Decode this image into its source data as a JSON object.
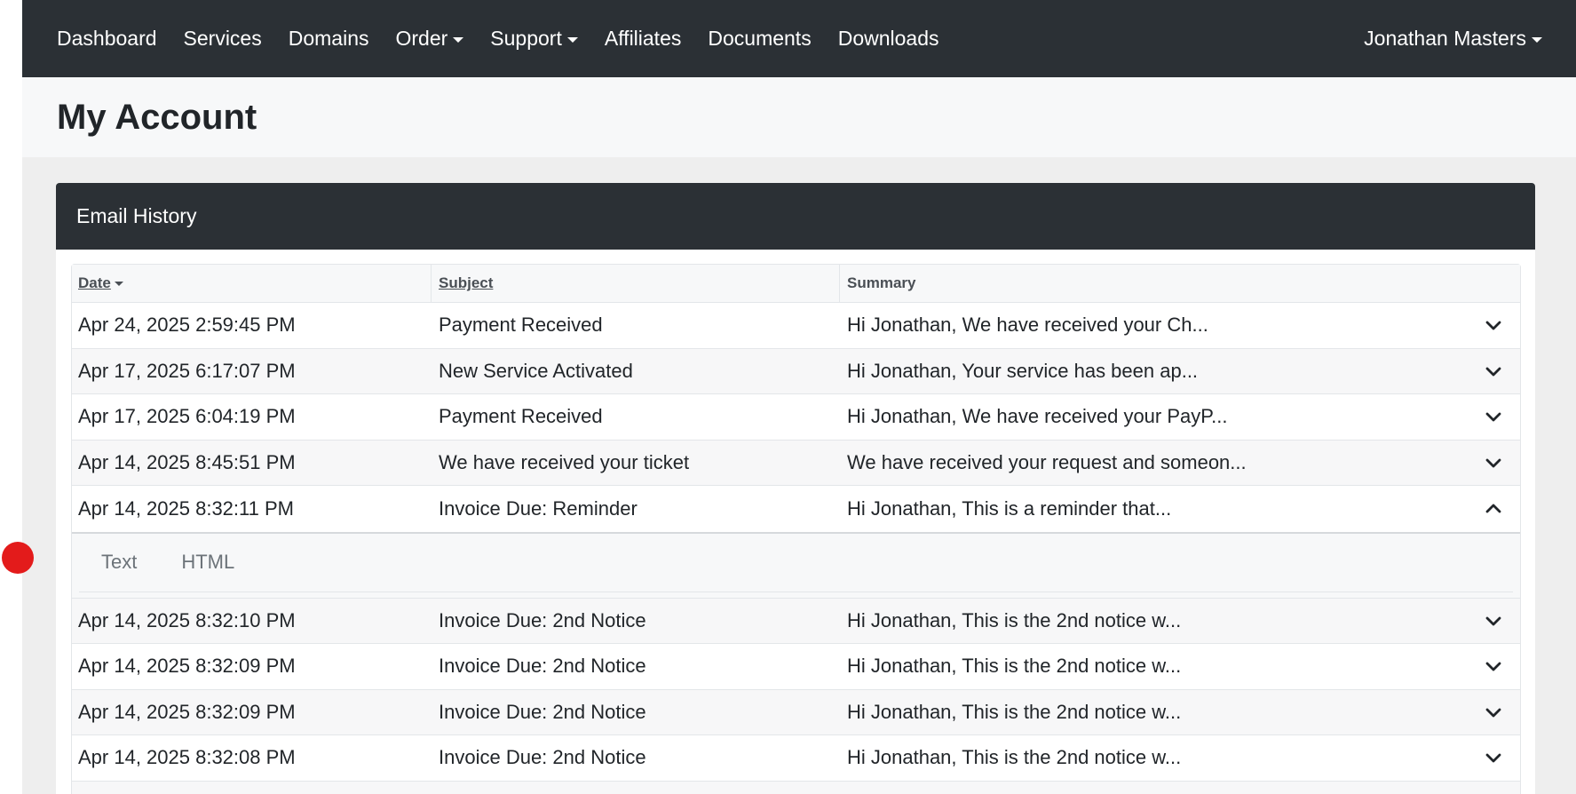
{
  "nav": {
    "items": [
      {
        "label": "Dashboard",
        "dropdown": false
      },
      {
        "label": "Services",
        "dropdown": false
      },
      {
        "label": "Domains",
        "dropdown": false
      },
      {
        "label": "Order",
        "dropdown": true
      },
      {
        "label": "Support",
        "dropdown": true
      },
      {
        "label": "Affiliates",
        "dropdown": false
      },
      {
        "label": "Documents",
        "dropdown": false
      },
      {
        "label": "Downloads",
        "dropdown": false
      }
    ],
    "user": "Jonathan Masters"
  },
  "page": {
    "title": "My Account"
  },
  "email_history": {
    "title": "Email History",
    "columns": {
      "date": "Date",
      "subject": "Subject",
      "summary": "Summary"
    },
    "rows": [
      {
        "date": "Apr 24, 2025 2:59:45 PM",
        "subject": "Payment Received",
        "summary": "Hi Jonathan, We have received your Ch...",
        "expanded": false
      },
      {
        "date": "Apr 17, 2025 6:17:07 PM",
        "subject": "New Service Activated",
        "summary": "Hi Jonathan, Your service has been ap...",
        "expanded": false
      },
      {
        "date": "Apr 17, 2025 6:04:19 PM",
        "subject": "Payment Received",
        "summary": "Hi Jonathan, We have received your PayP...",
        "expanded": false
      },
      {
        "date": "Apr 14, 2025 8:45:51 PM",
        "subject": "We have received your ticket",
        "summary": "We have received your request and someon...",
        "expanded": false
      },
      {
        "date": "Apr 14, 2025 8:32:11 PM",
        "subject": "Invoice Due: Reminder",
        "summary": "Hi Jonathan, This is a reminder that...",
        "expanded": true
      },
      {
        "date": "Apr 14, 2025 8:32:10 PM",
        "subject": "Invoice Due: 2nd Notice",
        "summary": "Hi Jonathan, This is the 2nd notice w...",
        "expanded": false
      },
      {
        "date": "Apr 14, 2025 8:32:09 PM",
        "subject": "Invoice Due: 2nd Notice",
        "summary": "Hi Jonathan, This is the 2nd notice w...",
        "expanded": false
      },
      {
        "date": "Apr 14, 2025 8:32:09 PM",
        "subject": "Invoice Due: 2nd Notice",
        "summary": "Hi Jonathan, This is the 2nd notice w...",
        "expanded": false
      },
      {
        "date": "Apr 14, 2025 8:32:08 PM",
        "subject": "Invoice Due: 2nd Notice",
        "summary": "Hi Jonathan, This is the 2nd notice w...",
        "expanded": false
      }
    ],
    "detail_tabs": [
      "Text",
      "HTML"
    ]
  },
  "colors": {
    "navbar": "#2b3035",
    "page_bg": "#eeeeee",
    "header_bg": "#f7f8f9",
    "marker": "#e31b1b"
  },
  "icons": {
    "expand": "chevron-down-icon",
    "collapse": "chevron-up-icon",
    "dropdown": "caret-down-icon",
    "sort": "sort-desc-icon"
  }
}
